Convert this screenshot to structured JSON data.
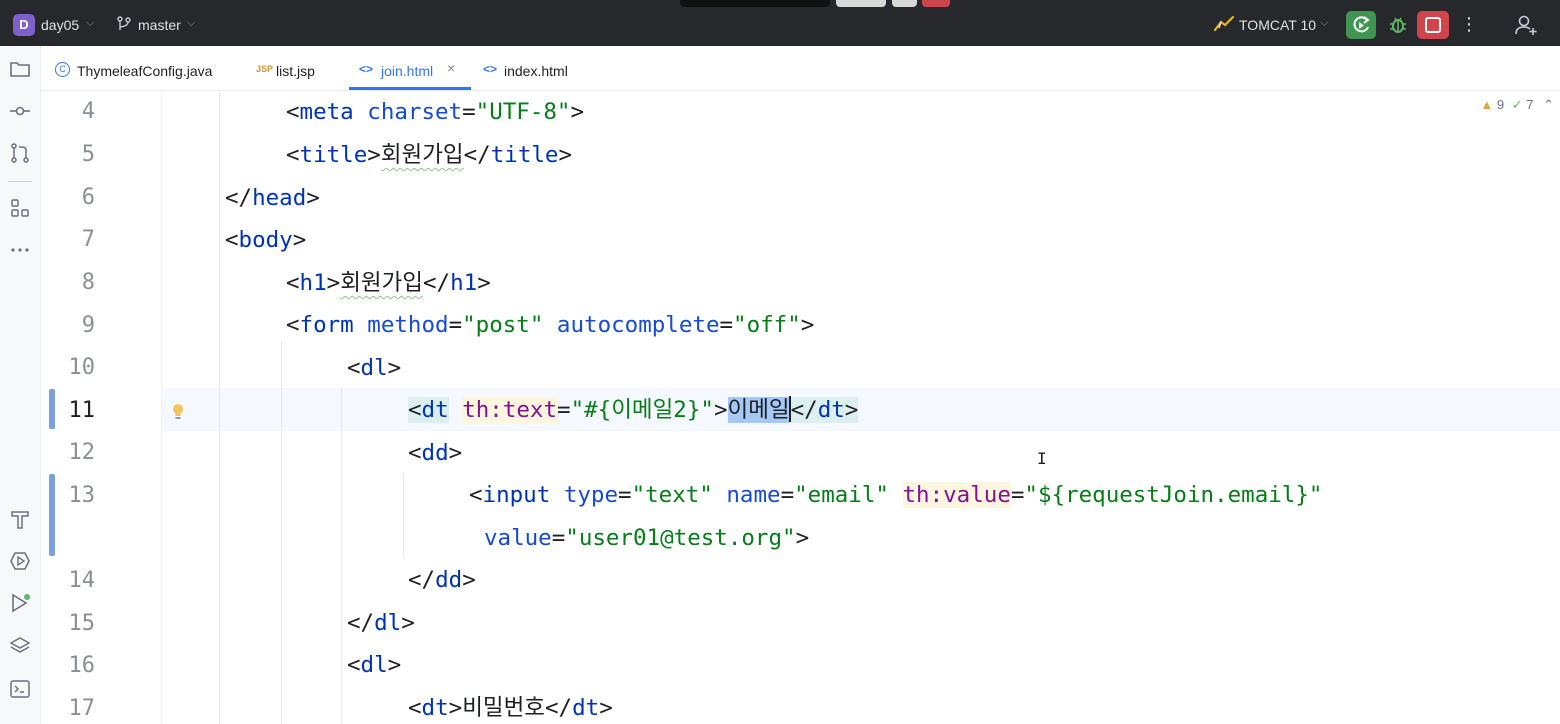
{
  "titlebar": {
    "project_initial": "D",
    "project_name": "day05",
    "branch": "master",
    "run_config": "TOMCAT 10",
    "more_label": "⋮"
  },
  "tabs": [
    {
      "label": "ThymeleafConfig.java",
      "icon": "C"
    },
    {
      "label": "list.jsp",
      "icon": "JSP"
    },
    {
      "label": "join.html",
      "icon": "<>",
      "active": true,
      "close": "×"
    },
    {
      "label": "index.html",
      "icon": "<>"
    }
  ],
  "editor": {
    "inspection_warnings": "9",
    "inspection_typos": "7",
    "line_numbers": [
      "4",
      "5",
      "6",
      "7",
      "8",
      "9",
      "10",
      "11",
      "12",
      "13",
      "14",
      "15",
      "16",
      "17"
    ],
    "current_line": "11",
    "lines": {
      "l4": {
        "open": "<",
        "tag": "meta",
        "attr": " charset",
        "eq": "=",
        "val": "\"UTF-8\"",
        "close": ">"
      },
      "l5": {
        "open": "<",
        "tag": "title",
        "gt": ">",
        "text": "회원가입",
        "end_open": "</",
        "end_tag": "title",
        "close": ">"
      },
      "l6": {
        "open": "</",
        "tag": "head",
        "close": ">"
      },
      "l7": {
        "open": "<",
        "tag": "body",
        "close": ">"
      },
      "l8": {
        "open": "<",
        "tag": "h1",
        "gt": ">",
        "text": "회원가입",
        "end_open": "</",
        "end_tag": "h1",
        "close": ">"
      },
      "l9": {
        "open": "<",
        "tag": "form",
        "attr1": " method",
        "eq1": "=",
        "val1": "\"post\"",
        "attr2": " autocomplete",
        "eq2": "=",
        "val2": "\"off\"",
        "close": ">"
      },
      "l10": {
        "open": "<",
        "tag": "dl",
        "close": ">"
      },
      "l11": {
        "open": "<",
        "tag": "dt",
        "sp": " ",
        "th": "th:text",
        "eq": "=",
        "val": "\"#{이메일2}\"",
        "gt": ">",
        "text": "이메일",
        "end_open": "</",
        "end_tag": "dt",
        "close": ">"
      },
      "l12": {
        "open": "<",
        "tag": "dd",
        "close": ">"
      },
      "l13": {
        "open": "<",
        "tag": "input",
        "attr1": " type",
        "eq1": "=",
        "val1": "\"text\"",
        "attr2": " name",
        "eq2": "=",
        "val2": "\"email\"",
        "sp": " ",
        "th": "th:value",
        "eq3": "=",
        "val3": "\"${requestJoin.email}\""
      },
      "l13b": {
        "attr": "value",
        "eq": "=",
        "val": "\"user01@test.org\"",
        "close": ">"
      },
      "l14": {
        "open": "</",
        "tag": "dd",
        "close": ">"
      },
      "l15": {
        "open": "</",
        "tag": "dl",
        "close": ">"
      },
      "l16": {
        "open": "<",
        "tag": "dl",
        "close": ">"
      },
      "l17": {
        "open": "<",
        "tag": "dt",
        "gt": ">",
        "text": "비밀번호",
        "end_open": "</",
        "end_tag": "dt",
        "close": ">"
      }
    }
  },
  "icons": {
    "left": [
      "folder-icon",
      "commit-icon",
      "pull-request-icon",
      "structure-icon",
      "more-icon",
      "build-icon",
      "services-icon",
      "run-icon",
      "layers-icon",
      "terminal-icon"
    ]
  },
  "colors": {
    "titlebar_bg": "#27282c",
    "tag": "#0033b3",
    "string": "#067d17",
    "thymeleaf_attr": "#871094",
    "selection": "#a6c8f5",
    "run_button": "#3f9652",
    "stop_button": "#d0454b",
    "active_tab": "#3574f0"
  }
}
